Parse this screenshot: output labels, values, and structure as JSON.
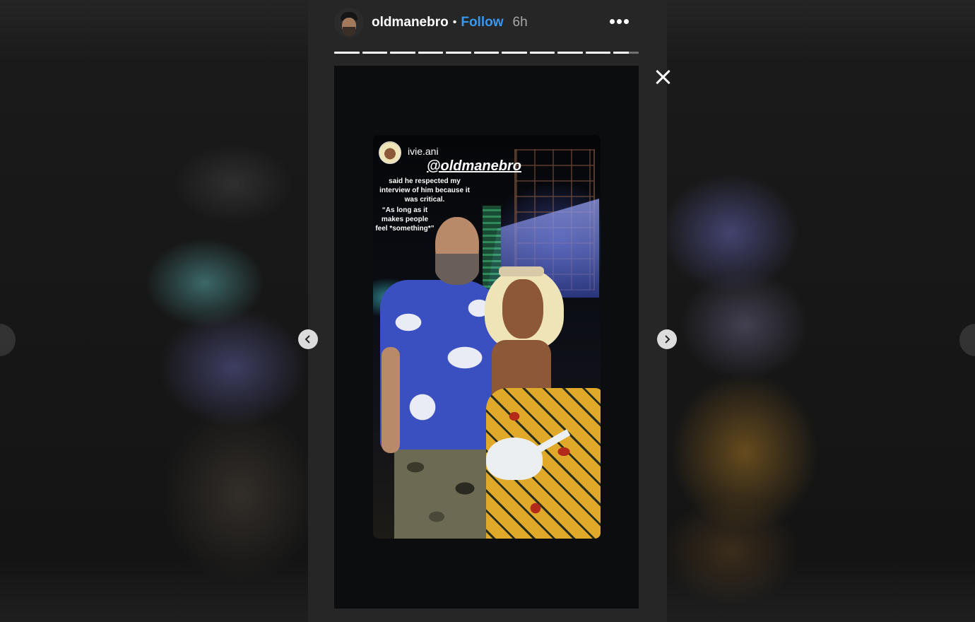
{
  "story": {
    "username": "oldmanebro",
    "separator": "•",
    "follow_label": "Follow",
    "time": "6h",
    "progress": {
      "segments": 11,
      "completed": 10,
      "current_fraction": 0.6
    }
  },
  "overlay": {
    "mention_user": "ivie.ani",
    "mention_tag": "@oldmanebro",
    "text_line_1": "said he respected my interview of him because it was critical.",
    "text_line_2": "“As long as it makes people feel *something*”"
  },
  "icons": {
    "more": "more-horizontal-icon",
    "close": "close-icon",
    "prev": "chevron-left-icon",
    "next": "chevron-right-icon"
  },
  "colors": {
    "follow": "#3897f0",
    "background": "#262626"
  }
}
